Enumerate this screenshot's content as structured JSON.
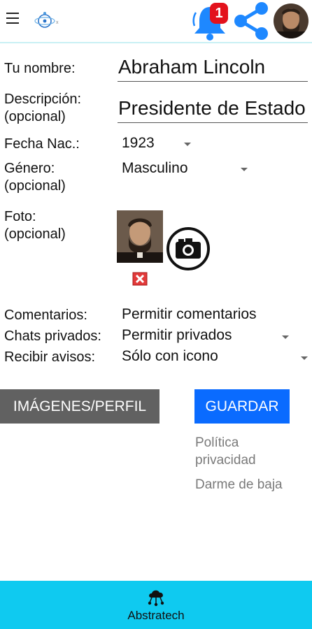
{
  "header": {
    "notification_count": "1",
    "icons": [
      "menu-icon",
      "app-logo",
      "bell-icon",
      "share-icon",
      "avatar"
    ]
  },
  "form": {
    "name": {
      "label": "Tu nombre:",
      "value": "Abraham Lincoln"
    },
    "description": {
      "label": "Descripción:\n(opcional)",
      "value": "Presidente de Estado"
    },
    "birth": {
      "label": "Fecha Nac.:",
      "value": "1923"
    },
    "gender": {
      "label": "Género:\n(opcional)",
      "value": "Masculino"
    },
    "photo": {
      "label": "Foto:\n(opcional)"
    },
    "comments": {
      "label": "Comentarios:",
      "value": "Permitir comentarios"
    },
    "private_chats": {
      "label": "Chats privados:",
      "value": "Permitir privados"
    },
    "notices": {
      "label": "Recibir avisos:",
      "value": "Sólo con icono"
    }
  },
  "actions": {
    "images_profile": "IMÁGENES/PERFIL",
    "save": "GUARDAR",
    "privacy": "Política\nprivacidad",
    "unsubscribe": "Darme de baja"
  },
  "footer": {
    "label": "Abstratech"
  },
  "colors": {
    "accent_blue": "#0a6bff",
    "footer_bg": "#0fcaf0",
    "gray_button": "#616161",
    "badge_red": "#e3121c",
    "icon_blue": "#1e88ff"
  }
}
